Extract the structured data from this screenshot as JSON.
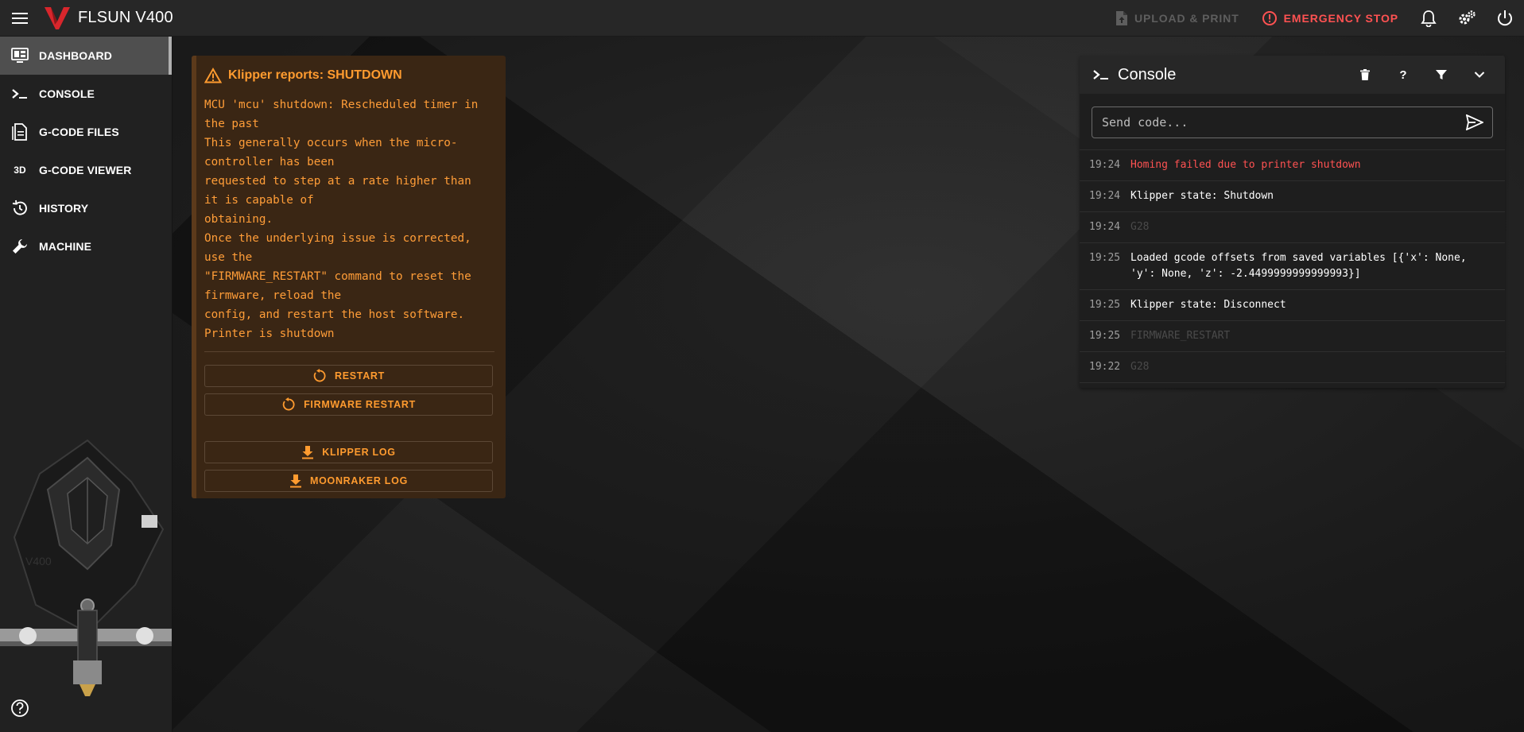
{
  "app": {
    "title": "FLSUN V400"
  },
  "topbar": {
    "upload_label": "UPLOAD & PRINT",
    "estop_label": "EMERGENCY STOP"
  },
  "sidebar": {
    "items": [
      {
        "label": "DASHBOARD",
        "icon": "monitor-dashboard-icon",
        "active": true
      },
      {
        "label": "CONSOLE",
        "icon": "console-prompt-icon"
      },
      {
        "label": "G-CODE FILES",
        "icon": "file-document-icon"
      },
      {
        "label": "G-CODE VIEWER",
        "icon": "3d-icon"
      },
      {
        "label": "HISTORY",
        "icon": "history-icon"
      },
      {
        "label": "MACHINE",
        "icon": "wrench-icon"
      }
    ],
    "viewer_badge": "3D",
    "printer_label": "V400"
  },
  "alert": {
    "title": "Klipper reports: SHUTDOWN",
    "message": "MCU 'mcu' shutdown: Rescheduled timer in\nthe past\nThis generally occurs when the micro-\ncontroller has been\nrequested to step at a rate higher than\nit is capable of\nobtaining.\nOnce the underlying issue is corrected,\nuse the\n\"FIRMWARE_RESTART\" command to reset the\nfirmware, reload the\nconfig, and restart the host software.\nPrinter is shutdown",
    "buttons": {
      "restart": "RESTART",
      "firmware_restart": "FIRMWARE RESTART",
      "klipper_log": "KLIPPER LOG",
      "moonraker_log": "MOONRAKER LOG"
    }
  },
  "console": {
    "title": "Console",
    "help_label": "?",
    "input_placeholder": "Send code...",
    "entries": [
      {
        "time": "19:24",
        "text": "Homing failed due to printer shutdown",
        "kind": "error"
      },
      {
        "time": "19:24",
        "text": "Klipper state: Shutdown",
        "kind": "normal"
      },
      {
        "time": "19:24",
        "text": "G28",
        "kind": "muted"
      },
      {
        "time": "19:25",
        "text": "Loaded gcode offsets from saved variables [{'x': None, 'y': None, 'z': -2.4499999999999993}]",
        "kind": "normal"
      },
      {
        "time": "19:25",
        "text": "Klipper state: Disconnect",
        "kind": "normal"
      },
      {
        "time": "19:25",
        "text": "FIRMWARE_RESTART",
        "kind": "muted"
      },
      {
        "time": "19:22",
        "text": "G28",
        "kind": "muted"
      }
    ]
  },
  "colors": {
    "accent_orange": "#ff9b2f",
    "error_red": "#ff5252",
    "brand_red": "#d8262c"
  }
}
